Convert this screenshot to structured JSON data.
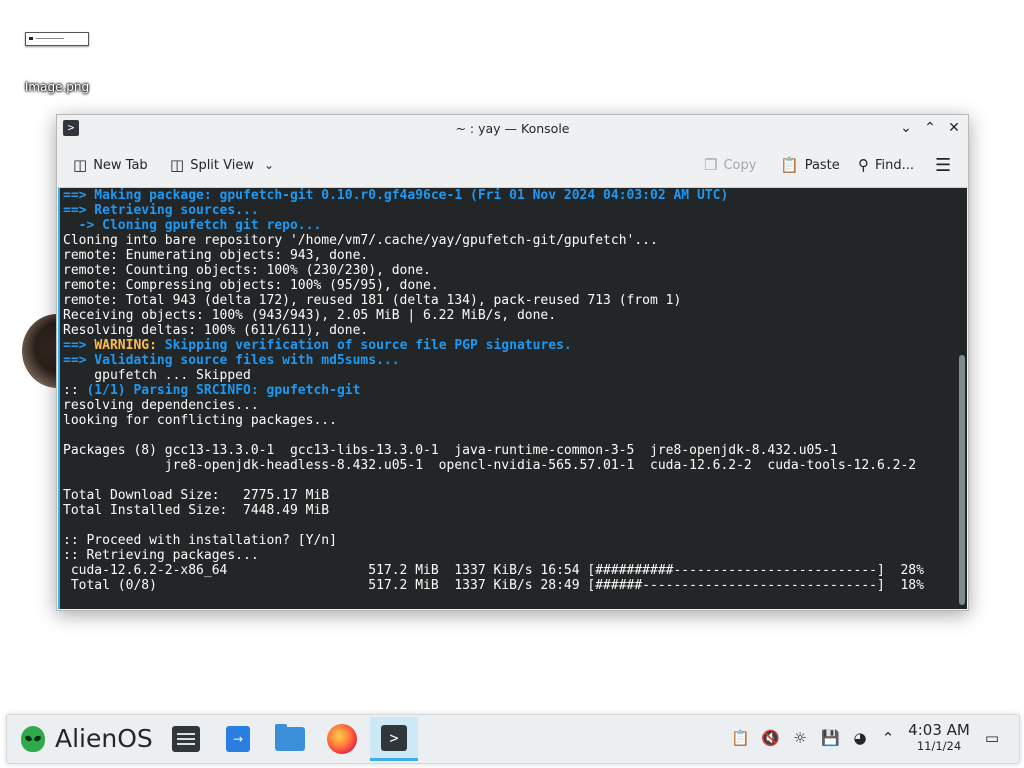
{
  "desktop": {
    "icons": [
      {
        "label": "Image.png"
      }
    ]
  },
  "window": {
    "title": "~ : yay — Konsole",
    "toolbar": {
      "new_tab": "New Tab",
      "split_view": "Split View",
      "copy": "Copy",
      "paste": "Paste",
      "find": "Find..."
    },
    "terminal_lines": [
      {
        "segments": [
          {
            "cls": "blue",
            "text": "==> Making package: gpufetch-git 0.10.r0.gf4a96ce-1 (Fri 01 Nov 2024 04:03:02 AM UTC)"
          }
        ]
      },
      {
        "segments": [
          {
            "cls": "blue",
            "text": "==> Retrieving sources..."
          }
        ]
      },
      {
        "segments": [
          {
            "cls": "blue",
            "text": "  -> Cloning gpufetch git repo..."
          }
        ]
      },
      {
        "segments": [
          {
            "cls": "",
            "text": "Cloning into bare repository '/home/vm7/.cache/yay/gpufetch-git/gpufetch'..."
          }
        ]
      },
      {
        "segments": [
          {
            "cls": "",
            "text": "remote: Enumerating objects: 943, done."
          }
        ]
      },
      {
        "segments": [
          {
            "cls": "",
            "text": "remote: Counting objects: 100% (230/230), done."
          }
        ]
      },
      {
        "segments": [
          {
            "cls": "",
            "text": "remote: Compressing objects: 100% (95/95), done."
          }
        ]
      },
      {
        "segments": [
          {
            "cls": "",
            "text": "remote: Total 943 (delta 172), reused 181 (delta 134), pack-reused 713 (from 1)"
          }
        ]
      },
      {
        "segments": [
          {
            "cls": "",
            "text": "Receiving objects: 100% (943/943), 2.05 MiB | 6.22 MiB/s, done."
          }
        ]
      },
      {
        "segments": [
          {
            "cls": "",
            "text": "Resolving deltas: 100% (611/611), done."
          }
        ]
      },
      {
        "segments": [
          {
            "cls": "blue",
            "text": "==> "
          },
          {
            "cls": "warn",
            "text": "WARNING: "
          },
          {
            "cls": "blue",
            "text": "Skipping verification of source file PGP signatures."
          }
        ]
      },
      {
        "segments": [
          {
            "cls": "blue",
            "text": "==> Validating source files with md5sums..."
          }
        ]
      },
      {
        "segments": [
          {
            "cls": "",
            "text": "    gpufetch ... Skipped"
          }
        ]
      },
      {
        "segments": [
          {
            "cls": "",
            "text": ":: "
          },
          {
            "cls": "blue",
            "text": "(1/1) Parsing SRCINFO: gpufetch-git"
          }
        ]
      },
      {
        "segments": [
          {
            "cls": "",
            "text": "resolving dependencies..."
          }
        ]
      },
      {
        "segments": [
          {
            "cls": "",
            "text": "looking for conflicting packages..."
          }
        ]
      },
      {
        "segments": [
          {
            "cls": "",
            "text": ""
          }
        ]
      },
      {
        "segments": [
          {
            "cls": "",
            "text": "Packages (8) gcc13-13.3.0-1  gcc13-libs-13.3.0-1  java-runtime-common-3-5  jre8-openjdk-8.432.u05-1"
          }
        ]
      },
      {
        "segments": [
          {
            "cls": "",
            "text": "             jre8-openjdk-headless-8.432.u05-1  opencl-nvidia-565.57.01-1  cuda-12.6.2-2  cuda-tools-12.6.2-2"
          }
        ]
      },
      {
        "segments": [
          {
            "cls": "",
            "text": ""
          }
        ]
      },
      {
        "segments": [
          {
            "cls": "",
            "text": "Total Download Size:   2775.17 MiB"
          }
        ]
      },
      {
        "segments": [
          {
            "cls": "",
            "text": "Total Installed Size:  7448.49 MiB"
          }
        ]
      },
      {
        "segments": [
          {
            "cls": "",
            "text": ""
          }
        ]
      },
      {
        "segments": [
          {
            "cls": "",
            "text": ":: Proceed with installation? [Y/n]"
          }
        ]
      },
      {
        "segments": [
          {
            "cls": "",
            "text": ":: Retrieving packages..."
          }
        ]
      },
      {
        "segments": [
          {
            "cls": "",
            "text": " cuda-12.6.2-2-x86_64                  517.2 MiB  1337 KiB/s 16:54 [##########--------------------------]  28%"
          }
        ]
      },
      {
        "segments": [
          {
            "cls": "",
            "text": " Total (0/8)                           517.2 MiB  1337 KiB/s 28:49 [######------------------------------]  18%"
          }
        ]
      }
    ]
  },
  "taskbar": {
    "launcher_label": "AlienOS",
    "clock_time": "4:03 AM",
    "clock_date": "11/1/24"
  }
}
